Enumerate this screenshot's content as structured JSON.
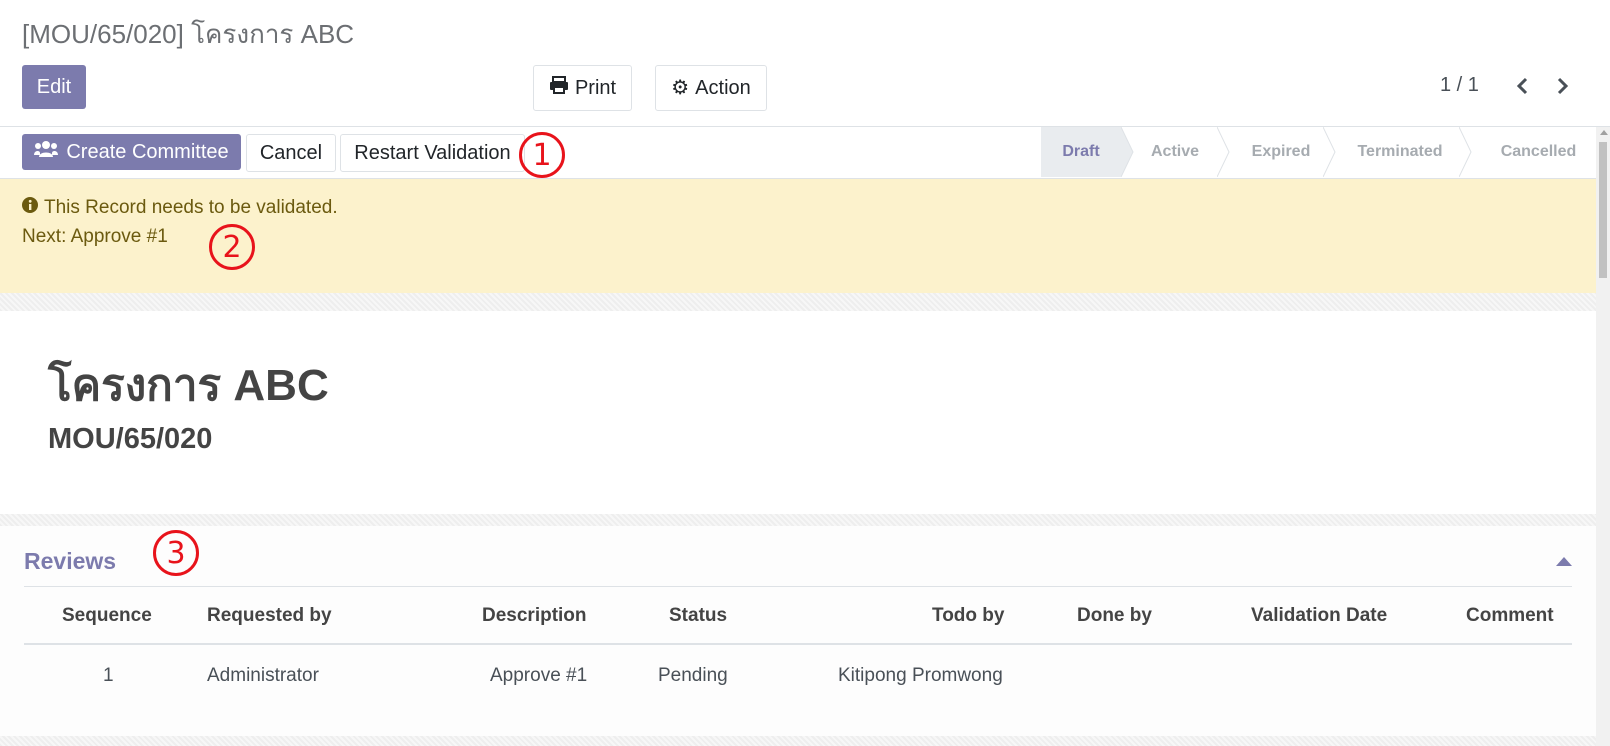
{
  "breadcrumb": "[MOU/65/020] โครงการ ABC",
  "control_panel": {
    "edit_label": "Edit",
    "print_label": "Print",
    "action_label": "Action",
    "pager_value": "1 / 1"
  },
  "statusbar": {
    "create_committee_label": "Create Committee",
    "cancel_label": "Cancel",
    "restart_validation_label": "Restart Validation",
    "stages": [
      "Draft",
      "Active",
      "Expired",
      "Terminated",
      "Cancelled"
    ],
    "active_stage": "Draft"
  },
  "annotations": [
    "1",
    "2",
    "3"
  ],
  "alert": {
    "line1": "This Record needs to be validated.",
    "line2": "Next: Approve #1"
  },
  "record": {
    "name": "โครงการ ABC",
    "reference": "MOU/65/020"
  },
  "reviews": {
    "title": "Reviews",
    "columns": [
      "Sequence",
      "Requested by",
      "Description",
      "Status",
      "Todo by",
      "Done by",
      "Validation Date",
      "Comment"
    ],
    "rows": [
      {
        "sequence": "1",
        "requested_by": "Administrator",
        "description": "Approve #1",
        "status": "Pending",
        "todo_by": "Kitipong Promwong",
        "done_by": "",
        "validation_date": "",
        "comment": ""
      }
    ]
  },
  "colors": {
    "primary": "#7c7bad",
    "alert_bg": "#fcf2cc",
    "annotation_red": "#e8131b"
  }
}
